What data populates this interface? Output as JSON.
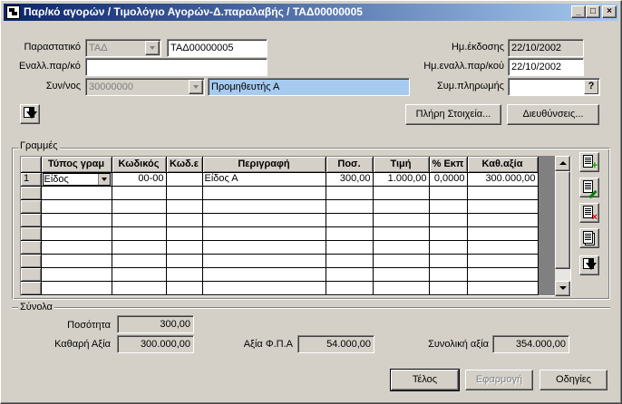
{
  "window": {
    "title": "Παρ/κό αγορών / Τιμολόγιο Αγορών-Δ.παραλαβής / ΤΑΔ00000005",
    "minimize_glyph": "_",
    "maximize_glyph": "□",
    "close_glyph": "×"
  },
  "header": {
    "document_label": "Παραστατικό",
    "document_type": "ΤΑΔ",
    "document_number": "ΤΑΔ00000005",
    "alt_doc_label": "Εναλλ.παρ/κό",
    "alt_doc_value": "",
    "partner_label": "Συν/νος",
    "partner_code": "30000000",
    "partner_name": "Προμηθευτής Α",
    "issue_date_label": "Ημ.έκδοσης",
    "issue_date": "22/10/2002",
    "alt_date_label": "Ημ.εναλλ.παρ/κού",
    "alt_date": "22/10/2002",
    "payment_label": "Συμ.πληρωμής",
    "payment_value": "",
    "help_glyph": "?",
    "full_data_button": "Πλήρη Στοιχεία...",
    "addresses_button": "Διευθύνσεις..."
  },
  "lines": {
    "group_title": "Γραμμές",
    "columns": [
      "",
      "Τύπος γραμ",
      "Κωδικός",
      "Κωδ.ε",
      "Περιγραφή",
      "Ποσ.",
      "Τιμή",
      "% Εκπ",
      "Καθ.αξία"
    ],
    "rows": [
      {
        "index": "1",
        "type": "Είδος",
        "code": "00-00",
        "code_e": "",
        "description": "Είδος Α",
        "qty": "300,00",
        "price": "1.000,00",
        "discount": "0,0000",
        "net": "300.000,00"
      }
    ]
  },
  "totals": {
    "group_title": "Σύνολα",
    "quantity_label": "Ποσότητα",
    "quantity": "300,00",
    "net_label": "Καθαρή Αξία",
    "net": "300.000,00",
    "vat_label": "Αξία Φ.Π.Α",
    "vat": "54.000,00",
    "total_label": "Συνολική αξία",
    "total": "354.000,00"
  },
  "footer": {
    "end_button": "Τέλος",
    "apply_button": "Εφαρμογή",
    "help_button": "Οδηγίες"
  },
  "colors": {
    "title_gradient_start": "#0a246a",
    "title_gradient_end": "#a6caf0",
    "face": "#d4d0c8",
    "selected_field": "#a6caf0"
  }
}
